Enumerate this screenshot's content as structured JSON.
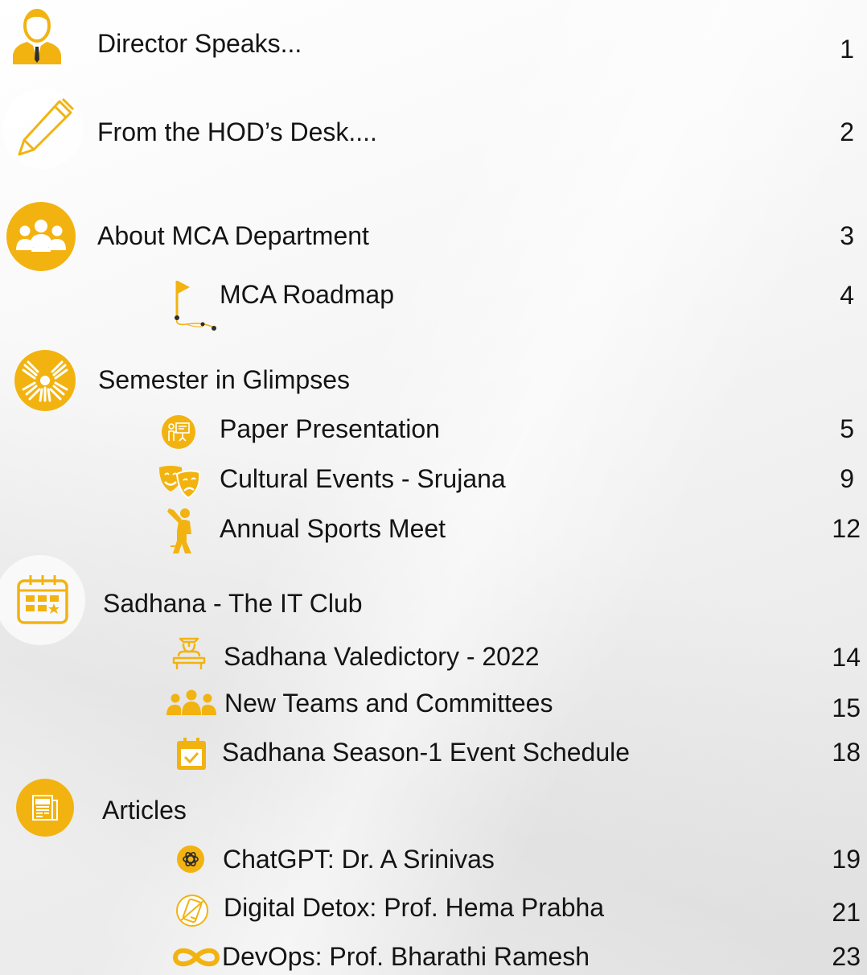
{
  "toc": [
    {
      "title": "Director Speaks...",
      "page": "1",
      "icon": "businessman-icon"
    },
    {
      "title": "From the HOD’s Desk....",
      "page": "2",
      "icon": "pen-icon"
    },
    {
      "title": "About MCA Department",
      "page": "3",
      "icon": "group-icon"
    },
    {
      "title": "MCA Roadmap",
      "page": "4",
      "icon": "roadmap-flag-icon"
    },
    {
      "title": "Semester in Glimpses",
      "page": "",
      "icon": "hands-together-icon"
    },
    {
      "title": "Paper Presentation",
      "page": "5",
      "icon": "presentation-icon"
    },
    {
      "title": "Cultural Events - Srujana",
      "page": "9",
      "icon": "theatre-masks-icon"
    },
    {
      "title": "Annual Sports Meet",
      "page": "12",
      "icon": "cricket-player-icon"
    },
    {
      "title": "Sadhana - The IT Club",
      "page": "",
      "icon": "calendar-grid-icon"
    },
    {
      "title": "Sadhana Valedictory - 2022",
      "page": "14",
      "icon": "graduate-podium-icon"
    },
    {
      "title": "New Teams and Committees",
      "page": "15",
      "icon": "team-icon"
    },
    {
      "title": "Sadhana Season-1 Event Schedule",
      "page": "18",
      "icon": "calendar-check-icon"
    },
    {
      "title": "Articles",
      "page": "",
      "icon": "newspaper-icon"
    },
    {
      "title": "ChatGPT: Dr. A Srinivas",
      "page": "19",
      "icon": "chatgpt-icon"
    },
    {
      "title": "Digital Detox: Prof. Hema Prabha",
      "page": "21",
      "icon": "no-phone-icon"
    },
    {
      "title": "DevOps: Prof. Bharathi Ramesh",
      "page": "23",
      "icon": "infinity-icon"
    }
  ],
  "colors": {
    "accent": "#f2b311",
    "text": "#141414"
  }
}
